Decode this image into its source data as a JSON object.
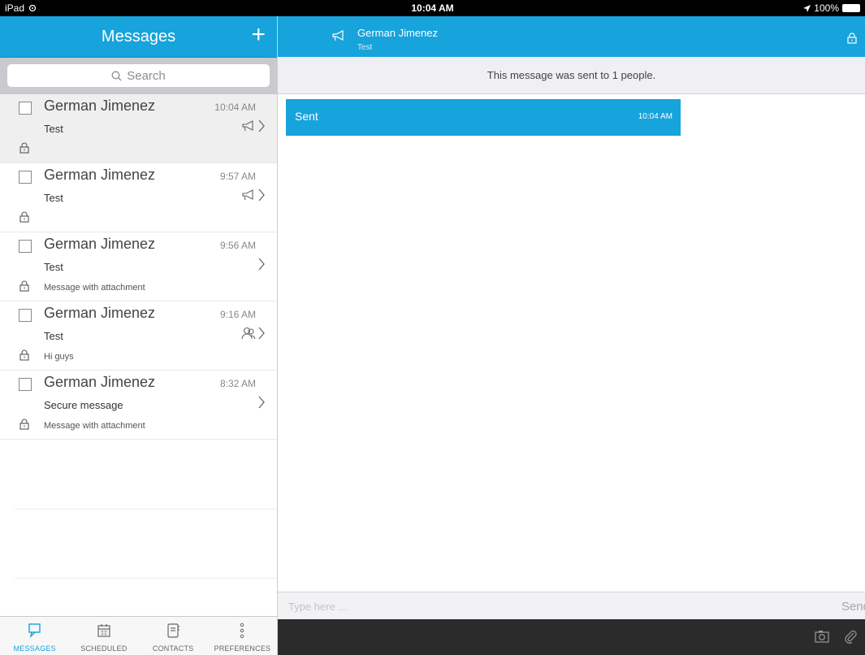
{
  "status_bar": {
    "device": "iPad",
    "time": "10:04 AM",
    "battery": "100%"
  },
  "left": {
    "title": "Messages",
    "compose_symbol": "+",
    "search_placeholder": "Search",
    "messages": [
      {
        "name": "German Jimenez",
        "time": "10:04 AM",
        "subject": "Test",
        "preview": "",
        "icon": "megaphone-icon",
        "selected": true
      },
      {
        "name": "German Jimenez",
        "time": "9:57 AM",
        "subject": "Test",
        "preview": "",
        "icon": "megaphone-icon",
        "selected": false
      },
      {
        "name": "German Jimenez",
        "time": "9:56 AM",
        "subject": "Test",
        "preview": "Message with attachment",
        "icon": "",
        "selected": false
      },
      {
        "name": "German Jimenez",
        "time": "9:16 AM",
        "subject": "Test",
        "preview": "Hi guys",
        "icon": "group-icon",
        "selected": false
      },
      {
        "name": "German Jimenez",
        "time": "8:32 AM",
        "subject": "Secure message",
        "preview": "Message with attachment",
        "icon": "",
        "selected": false
      }
    ],
    "tabs": [
      {
        "label": "MESSAGES",
        "icon": "messages-icon",
        "active": true
      },
      {
        "label": "SCHEDULED",
        "icon": "calendar-icon",
        "active": false
      },
      {
        "label": "CONTACTS",
        "icon": "contacts-icon",
        "active": false
      },
      {
        "label": "PREFERENCES",
        "icon": "more-vertical-icon",
        "active": false
      }
    ]
  },
  "right": {
    "header_name": "German Jimenez",
    "header_subject": "Test",
    "notice": "This message was sent to 1 people.",
    "bubble_text": "Sent",
    "bubble_time": "10:04 AM",
    "input_placeholder": "Type here ...",
    "send_label": "Send"
  },
  "colors": {
    "accent": "#17a3db",
    "toolbar": "#2b2b2b"
  }
}
